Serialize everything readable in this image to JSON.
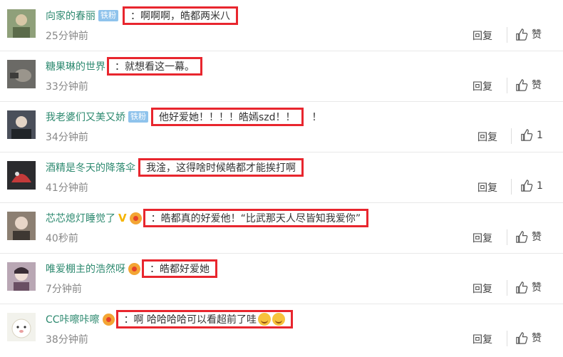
{
  "comments": [
    {
      "user": "向家的春丽",
      "badge": "铁粉",
      "text": "：啊啊啊，皓都两米八",
      "extra": "",
      "time": "25分钟前",
      "reply": "回复",
      "like": "赞",
      "avatar_color": "#8fa07a"
    },
    {
      "user": "糖果琳的世界",
      "badge": "",
      "text": "：就想看这一幕。",
      "extra": "",
      "time": "33分钟前",
      "reply": "回复",
      "like": "赞",
      "avatar_color": "#6b6a66"
    },
    {
      "user": "我老婆们又美又娇",
      "badge": "铁粉",
      "text": "他好爱她！！！！皓嫣szd！！",
      "extra": "！",
      "time": "34分钟前",
      "reply": "回复",
      "like": "1",
      "avatar_color": "#4a4f5a"
    },
    {
      "user": "酒精是冬天的降落伞",
      "badge": "",
      "text": "我淦，这得啥时候皓都才能挨打啊",
      "extra": "",
      "time": "41分钟前",
      "reply": "回复",
      "like": "1",
      "avatar_color": "#2b2b2e"
    },
    {
      "user": "芯芯熄灯睡觉了",
      "badge": "",
      "text": "：皓都真的好爱他！“比武那天人尽皆知我爱你”",
      "extra": "",
      "time": "40秒前",
      "reply": "回复",
      "like": "赞",
      "avatar_color": "#8c7f72"
    },
    {
      "user": "唯爱棚主的浩然呀",
      "badge": "",
      "text": "：皓都好爱她",
      "extra": "",
      "time": "7分钟前",
      "reply": "回复",
      "like": "赞",
      "avatar_color": "#b9a7b4"
    },
    {
      "user": "CC咔嚓咔嚓",
      "badge": "",
      "text": "：啊 哈哈哈哈可以看超前了哇",
      "extra": "",
      "time": "38分钟前",
      "reply": "回复",
      "like": "赞",
      "avatar_color": "#f2f2ec"
    }
  ]
}
